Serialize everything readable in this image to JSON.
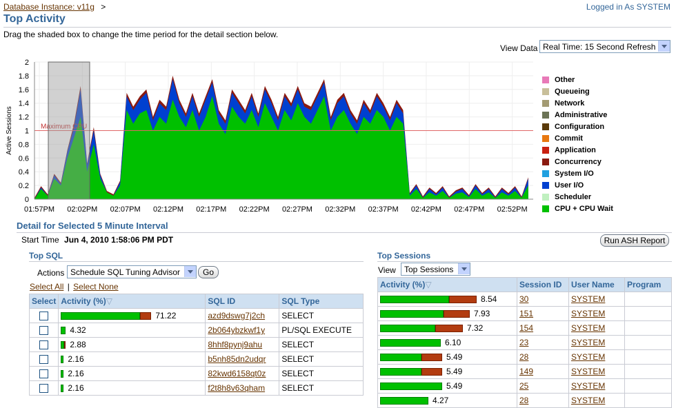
{
  "header": {
    "breadcrumb_link": "Database Instance: v11g",
    "breadcrumb_sep": ">",
    "logged_in": "Logged in As SYSTEM",
    "page_title": "Top Activity",
    "instructions": "Drag the shaded box to change the time period for the detail section below."
  },
  "view_data": {
    "label": "View Data",
    "selected": "Real Time: 15 Second Refresh"
  },
  "chart_data": {
    "type": "area",
    "ylabel": "Active Sessions",
    "ylim": [
      0,
      2
    ],
    "yticks": [
      "0",
      "0.2",
      "0.4",
      "0.6",
      "0.8",
      "1",
      "1.2",
      "1.4",
      "1.6",
      "1.8",
      "2"
    ],
    "xticks": [
      "01:57PM",
      "02:02PM",
      "02:07PM",
      "02:12PM",
      "02:17PM",
      "02:22PM",
      "02:27PM",
      "02:32PM",
      "02:37PM",
      "02:42PM",
      "02:47PM",
      "02:52PM"
    ],
    "threshold": {
      "label": "Maximum CPU",
      "value": 1,
      "color": "#e06666"
    },
    "selection": {
      "from": "01:58PM",
      "to": "02:03PM"
    },
    "series_colors": {
      "cpu": "#00c000",
      "user_io": "#0040d0",
      "system_io": "#20a0e0",
      "concurrency": "#8b1a10",
      "other": "#e87ab8"
    },
    "cpu_values": [
      0,
      0.15,
      0.05,
      0.3,
      0.2,
      0.6,
      0.9,
      1.2,
      0.4,
      0.8,
      0.3,
      0.1,
      0.05,
      0.2,
      1.3,
      1.1,
      1.25,
      1.3,
      1.0,
      1.2,
      1.1,
      1.45,
      1.2,
      1.05,
      1.3,
      1.0,
      1.2,
      1.5,
      1.1,
      0.95,
      1.35,
      1.2,
      1.1,
      1.3,
      1.05,
      1.4,
      1.2,
      1.0,
      1.3,
      1.15,
      1.4,
      1.2,
      1.1,
      1.3,
      1.5,
      1.0,
      1.2,
      1.3,
      1.1,
      0.95,
      1.2,
      1.1,
      1.3,
      1.2,
      1.0,
      1.2,
      1.1,
      0.05,
      0.15,
      0.02,
      0.1,
      0.05,
      0.12,
      0.02,
      0.08,
      0.1,
      0.03,
      0.15,
      0.05,
      0.1,
      0.02,
      0.1,
      0.05,
      0.12,
      0.02,
      0.2
    ],
    "io_values": [
      0,
      0.02,
      0,
      0.05,
      0.02,
      0.1,
      0.15,
      0.4,
      0.1,
      0.2,
      0.05,
      0,
      0,
      0.05,
      0.2,
      0.2,
      0.2,
      0.25,
      0.15,
      0.2,
      0.2,
      0.3,
      0.2,
      0.15,
      0.2,
      0.2,
      0.25,
      0.2,
      0.15,
      0.15,
      0.2,
      0.2,
      0.15,
      0.2,
      0.15,
      0.2,
      0.2,
      0.15,
      0.2,
      0.2,
      0.2,
      0.15,
      0.2,
      0.2,
      0.2,
      0.15,
      0.2,
      0.2,
      0.15,
      0.15,
      0.2,
      0.15,
      0.2,
      0.15,
      0.15,
      0.2,
      0.15,
      0.02,
      0.05,
      0,
      0.05,
      0.02,
      0.05,
      0,
      0.03,
      0.05,
      0.01,
      0.05,
      0.02,
      0.05,
      0,
      0.05,
      0.02,
      0.05,
      0,
      0.1
    ]
  },
  "legend": [
    {
      "label": "Other",
      "color": "#e87ab8"
    },
    {
      "label": "Queueing",
      "color": "#c8bf9a"
    },
    {
      "label": "Network",
      "color": "#a39b73"
    },
    {
      "label": "Administrative",
      "color": "#6b7355"
    },
    {
      "label": "Configuration",
      "color": "#5a3a0a"
    },
    {
      "label": "Commit",
      "color": "#e8780f"
    },
    {
      "label": "Application",
      "color": "#c82010"
    },
    {
      "label": "Concurrency",
      "color": "#8b1a10"
    },
    {
      "label": "System I/O",
      "color": "#20a0e0"
    },
    {
      "label": "User I/O",
      "color": "#0040d0"
    },
    {
      "label": "Scheduler",
      "color": "#c0f0c0"
    },
    {
      "label": "CPU + CPU Wait",
      "color": "#00c000"
    }
  ],
  "detail": {
    "title": "Detail for Selected 5 Minute Interval",
    "start_time_label": "Start Time",
    "start_time_value": "Jun 4, 2010 1:58:06 PM PDT",
    "run_ash_button": "Run ASH Report"
  },
  "top_sql": {
    "title": "Top SQL",
    "actions_label": "Actions",
    "actions_selected": "Schedule SQL Tuning Advisor",
    "go_button": "Go",
    "select_all": "Select All",
    "separator": "|",
    "select_none": "Select None",
    "columns": [
      "Select",
      "Activity (%)",
      "SQL ID",
      "SQL Type"
    ],
    "rows": [
      {
        "activity": "71.22",
        "pct": 71.22,
        "conc": 16,
        "sql_id": "azd9dswg7j2ch",
        "type": "SELECT"
      },
      {
        "activity": "4.32",
        "pct": 4.32,
        "conc": 0,
        "sql_id": "2b064ybzkwf1y",
        "type": "PL/SQL EXECUTE"
      },
      {
        "activity": "2.88",
        "pct": 2.88,
        "conc": 1,
        "sql_id": "8hhf8pynj9ahu",
        "type": "SELECT"
      },
      {
        "activity": "2.16",
        "pct": 2.16,
        "conc": 0,
        "sql_id": "b5nh85dn2udqr",
        "type": "SELECT"
      },
      {
        "activity": "2.16",
        "pct": 2.16,
        "conc": 0,
        "sql_id": "82kwd6158qt0z",
        "type": "SELECT"
      },
      {
        "activity": "2.16",
        "pct": 2.16,
        "conc": 0,
        "sql_id": "f2t8h8v63qham",
        "type": "SELECT"
      }
    ]
  },
  "top_sessions": {
    "title": "Top Sessions",
    "view_label": "View",
    "view_selected": "Top Sessions",
    "columns": [
      "Activity (%)",
      "Session ID",
      "User Name",
      "Program"
    ],
    "rows": [
      {
        "activity": "8.54",
        "green": 100,
        "red": 40,
        "sid": "30",
        "user": "SYSTEM"
      },
      {
        "activity": "7.93",
        "green": 92,
        "red": 38,
        "sid": "151",
        "user": "SYSTEM"
      },
      {
        "activity": "7.32",
        "green": 80,
        "red": 40,
        "sid": "154",
        "user": "SYSTEM"
      },
      {
        "activity": "6.10",
        "green": 88,
        "red": 0,
        "sid": "23",
        "user": "SYSTEM"
      },
      {
        "activity": "5.49",
        "green": 60,
        "red": 30,
        "sid": "28",
        "user": "SYSTEM"
      },
      {
        "activity": "5.49",
        "green": 60,
        "red": 30,
        "sid": "149",
        "user": "SYSTEM"
      },
      {
        "activity": "5.49",
        "green": 90,
        "red": 0,
        "sid": "25",
        "user": "SYSTEM"
      },
      {
        "activity": "4.27",
        "green": 70,
        "red": 0,
        "sid": "28",
        "user": "SYSTEM"
      }
    ]
  }
}
